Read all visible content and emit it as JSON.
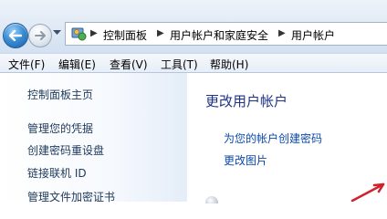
{
  "address_bar": {
    "breadcrumbs": [
      "控制面板",
      "用户帐户和家庭安全",
      "用户帐户"
    ]
  },
  "menu": [
    "文件(F)",
    "编辑(E)",
    "查看(V)",
    "工具(T)",
    "帮助(H)"
  ],
  "left_pane": {
    "items": [
      "控制面板主页",
      "管理您的凭据",
      "创建密码重设盘",
      "链接联机 ID",
      "管理文件加密证书"
    ]
  },
  "main": {
    "title": "更改用户帐户",
    "links": [
      "为您的帐户创建密码",
      "更改图片"
    ]
  },
  "colors": {
    "link": "#0b4aa8",
    "heading": "#1e3287",
    "nav_link": "#1e395b",
    "annotation_arrow": "#d0202a"
  },
  "icons": [
    "back-arrow-icon",
    "forward-arrow-icon",
    "history-dropdown-icon",
    "control-panel-icon",
    "breadcrumb-separator-icon",
    "user-account-icon",
    "red-arrow-annotation"
  ]
}
